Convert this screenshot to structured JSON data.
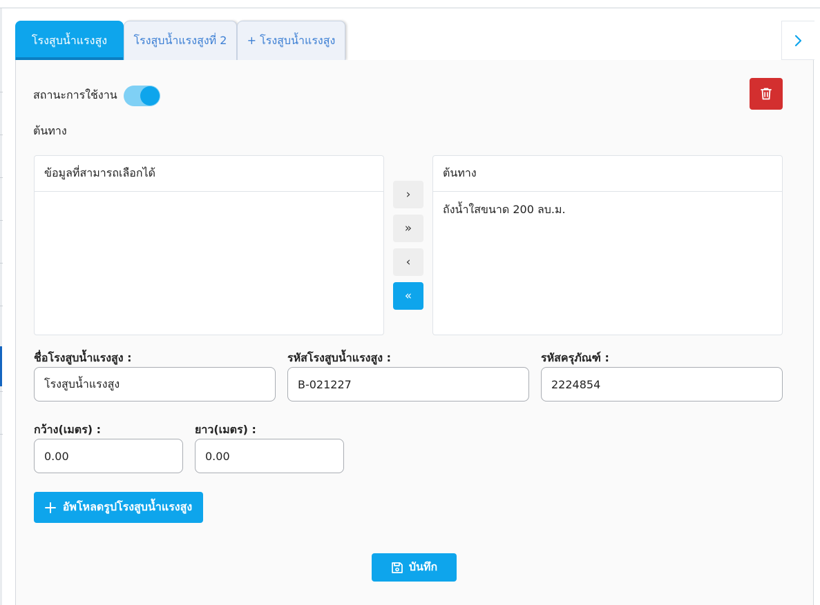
{
  "tabs": [
    {
      "label": "โรงสูบน้ำแรงสูง"
    },
    {
      "label": "โรงสูบน้ำแรงสูงที่ 2"
    },
    {
      "label": "+ โรงสูบน้ำแรงสูง"
    }
  ],
  "status": {
    "label": "สถานะการใช้งาน",
    "enabled": true
  },
  "source_section": {
    "label": "ต้นทาง"
  },
  "picklist": {
    "available_header": "ข้อมูลที่สามารถเลือกได้",
    "available_items": [],
    "selected_header": "ต้นทาง",
    "selected_items": [
      "ถังน้ำใสขนาด 200 ลบ.ม."
    ],
    "buttons": {
      "move_right": "›",
      "move_all_right": "»",
      "move_left": "‹",
      "move_all_left": "«"
    }
  },
  "form": {
    "station_name": {
      "label": "ชื่อโรงสูบน้ำแรงสูง :",
      "value": "โรงสูบน้ำแรงสูง"
    },
    "station_code": {
      "label": "รหัสโรงสูบน้ำแรงสูง :",
      "value": "B-021227"
    },
    "equipment_code": {
      "label": "รหัสครุภัณฑ์ :",
      "value": "2224854"
    },
    "width": {
      "label": "กว้าง(เมตร) :",
      "value": "0.00"
    },
    "length": {
      "label": "ยาว(เมตร) :",
      "value": "0.00"
    }
  },
  "upload_button": {
    "label": "อัพโหลดรูปโรงสูบน้ำแรงสูง",
    "icon": "plus-icon"
  },
  "save_button": {
    "label": "บันทึก",
    "icon": "floppy-disk-icon"
  },
  "delete_button": {
    "icon": "trash-icon"
  },
  "tab_nav": {
    "icon": "chevron-right-icon"
  },
  "colors": {
    "primary": "#0ea5ec",
    "danger": "#d32f2f",
    "toggle_track": "#7fd0f5"
  }
}
